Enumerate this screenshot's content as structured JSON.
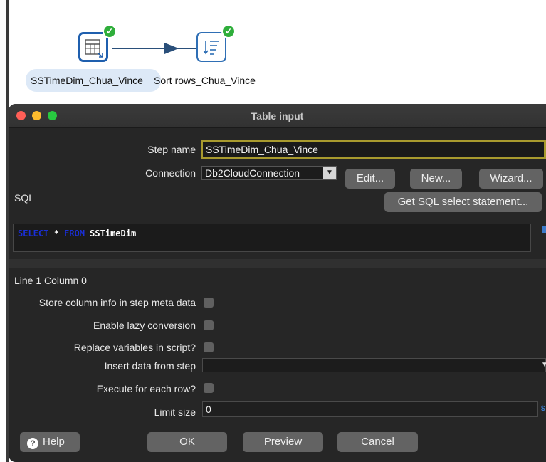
{
  "canvas": {
    "step1": {
      "label": "SSTimeDim_Chua_Vince",
      "status": "ok"
    },
    "step2": {
      "label": "Sort rows_Chua_Vince",
      "status": "ok"
    },
    "status_icon": "check-icon",
    "check_glyph": "✓"
  },
  "dialog": {
    "title": "Table input",
    "step_name": {
      "label": "Step name",
      "value": "SSTimeDim_Chua_Vince"
    },
    "connection": {
      "label": "Connection",
      "value": "Db2CloudConnection",
      "arrow": "▼"
    },
    "buttons": {
      "edit": "Edit...",
      "new": "New...",
      "wizard": "Wizard...",
      "get_sql": "Get SQL select statement..."
    },
    "sql": {
      "label": "SQL",
      "kw_select": "SELECT",
      "star": " * ",
      "kw_from": "FROM",
      "table": " SSTimeDim"
    },
    "position": "Line 1 Column 0",
    "options": {
      "store_column_info": "Store column info in step meta data",
      "lazy_conversion": "Enable lazy conversion",
      "replace_variables": "Replace variables in script?",
      "insert_data_from_step": "Insert data from step",
      "insert_arrow": "▼",
      "execute_each_row": "Execute for each row?",
      "limit_size": "Limit size",
      "limit_value": "0",
      "variable_glyph": "$"
    },
    "footer": {
      "help": "Help",
      "help_glyph": "?",
      "ok": "OK",
      "preview": "Preview",
      "cancel": "Cancel"
    }
  },
  "colors": {
    "dialog_bg": "#262626",
    "field_highlight": "#a89a2e",
    "sql_keyword": "#1a2fd8",
    "status_ok": "#2fae3b",
    "step_border": "#2f6fb5"
  }
}
